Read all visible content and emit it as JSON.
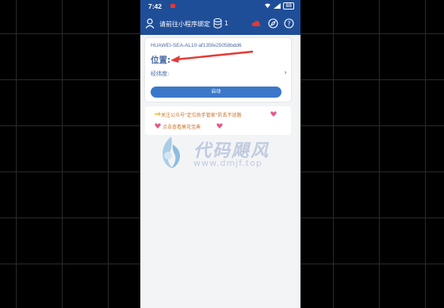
{
  "statusbar": {
    "time": "7:42",
    "battery": "88"
  },
  "appbar": {
    "title": "请前往小程序绑定",
    "count": "1"
  },
  "card": {
    "device": "HUAWEI-SEA-AL10-af135fe25058bdd6",
    "position_label": "位置:",
    "coord_label": "经纬度:",
    "start_button": "启动"
  },
  "notice": {
    "line1": "关注公众号\"定位助手管家\"防丢不迷路",
    "line2": "点击查看莫花宝典"
  },
  "watermark": {
    "brand": "代码飓风",
    "url": "www.dmjf.top"
  },
  "colors": {
    "primary": "#1f4e98",
    "button": "#3b78c9",
    "accent": "#e53935"
  }
}
